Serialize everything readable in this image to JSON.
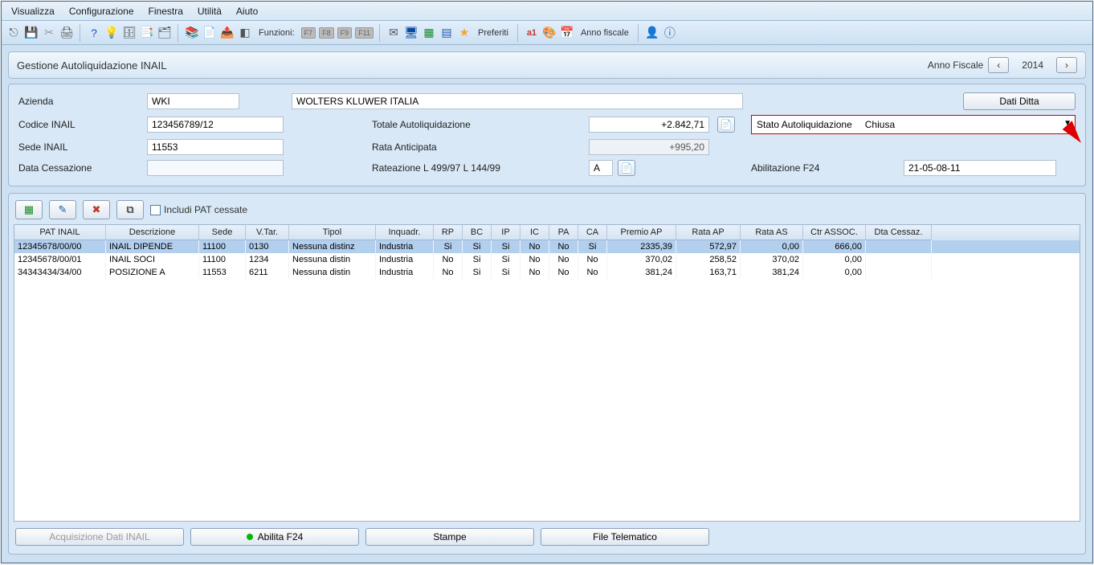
{
  "menu": [
    "Visualizza",
    "Configurazione",
    "Finestra",
    "Utilità",
    "Aiuto"
  ],
  "toolbar": {
    "funzioni_label": "Funzioni:",
    "fkeys": [
      "F7",
      "F8",
      "F9",
      "F11"
    ],
    "preferiti": "Preferiti",
    "anno_fiscale": "Anno fiscale"
  },
  "panel": {
    "title": "Gestione Autoliquidazione INAIL",
    "fiscal_label": "Anno Fiscale",
    "fiscal_year": "2014"
  },
  "form": {
    "azienda_lbl": "Azienda",
    "azienda_code": "WKI",
    "azienda_name": "WOLTERS KLUWER ITALIA",
    "dati_ditta_btn": "Dati Ditta",
    "codice_lbl": "Codice INAIL",
    "codice_val": "123456789/12",
    "totale_lbl": "Totale Autoliquidazione",
    "totale_val": "+2.842,71",
    "stato_lbl": "Stato Autoliquidazione",
    "stato_val": "Chiusa",
    "sede_lbl": "Sede INAIL",
    "sede_val": "11553",
    "rata_ant_lbl": "Rata Anticipata",
    "rata_ant_val": "+995,20",
    "data_cess_lbl": "Data Cessazione",
    "data_cess_val": "",
    "rateazione_lbl": "Rateazione L 499/97 L 144/99",
    "rateazione_val": "A",
    "abilitazione_lbl": "Abilitazione F24",
    "abilitazione_val": "21-05-08-11"
  },
  "table_toolbar": {
    "includi_lbl": "Includi PAT cessate"
  },
  "grid": {
    "headers": [
      "PAT INAIL",
      "Descrizione",
      "Sede",
      "V.Tar.",
      "Tipol",
      "Inquadr.",
      "RP",
      "BC",
      "IP",
      "IC",
      "PA",
      "CA",
      "Premio AP",
      "Rata AP",
      "Rata AS",
      "Ctr ASSOC.",
      "Dta Cessaz."
    ],
    "rows": [
      {
        "pat": "12345678/00/00",
        "desc": "INAIL DIPENDE",
        "sede": "11100",
        "vtar": "0130",
        "tipol": "Nessuna distinz",
        "inq": "Industria",
        "rp": "Si",
        "bc": "Si",
        "ip": "Si",
        "ic": "No",
        "pa": "No",
        "ca": "Si",
        "premio": "2335,39",
        "rataap": "572,97",
        "rataas": "0,00",
        "ctr": "666,00",
        "dta": "",
        "selected": true
      },
      {
        "pat": "12345678/00/01",
        "desc": "INAIL SOCI",
        "sede": "11100",
        "vtar": "1234",
        "tipol": "Nessuna distin",
        "inq": "Industria",
        "rp": "No",
        "bc": "Si",
        "ip": "Si",
        "ic": "No",
        "pa": "No",
        "ca": "No",
        "premio": "370,02",
        "rataap": "258,52",
        "rataas": "370,02",
        "ctr": "0,00",
        "dta": "",
        "selected": false
      },
      {
        "pat": "34343434/34/00",
        "desc": "POSIZIONE A",
        "sede": "11553",
        "vtar": "6211",
        "tipol": "Nessuna distin",
        "inq": "Industria",
        "rp": "No",
        "bc": "Si",
        "ip": "Si",
        "ic": "No",
        "pa": "No",
        "ca": "No",
        "premio": "381,24",
        "rataap": "163,71",
        "rataas": "381,24",
        "ctr": "0,00",
        "dta": "",
        "selected": false
      }
    ]
  },
  "bottom": {
    "acquisizione": "Acquisizione Dati INAIL",
    "abilita": "Abilita F24",
    "stampe": "Stampe",
    "file_telematico": "File Telematico"
  }
}
